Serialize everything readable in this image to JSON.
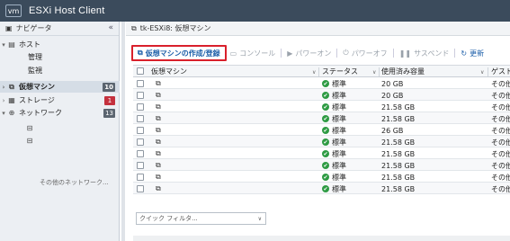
{
  "app": {
    "logo": "vm",
    "title": "ESXi Host Client"
  },
  "sidebar": {
    "header": "ナビゲータ",
    "collapse": "«",
    "host": "ホスト",
    "manage": "管理",
    "monitor": "監視",
    "vms": {
      "label": "仮想マシン",
      "count": "10"
    },
    "storage": {
      "label": "ストレージ",
      "count": "1"
    },
    "network": {
      "label": "ネットワーク",
      "count": "13"
    },
    "more": "その他のネットワーク..."
  },
  "main": {
    "breadcrumb": "tk-ESXi8: 仮想マシン",
    "toolbar": {
      "create": "仮想マシンの作成/登録",
      "console": "コンソール",
      "power_on": "パワーオン",
      "power_off": "パワーオフ",
      "suspend": "サスペンド",
      "refresh": "更新"
    },
    "columns": {
      "name": "仮想マシン",
      "status": "ステータス",
      "used": "使用済み容量",
      "guest": "ゲスト"
    },
    "rows": [
      {
        "status": "標準",
        "used": "20 GB",
        "guest": "その他"
      },
      {
        "status": "標準",
        "used": "20 GB",
        "guest": "その他"
      },
      {
        "status": "標準",
        "used": "21.58 GB",
        "guest": "その他"
      },
      {
        "status": "標準",
        "used": "21.58 GB",
        "guest": "その他"
      },
      {
        "status": "標準",
        "used": "26 GB",
        "guest": "その他"
      },
      {
        "status": "標準",
        "used": "21.58 GB",
        "guest": "その他"
      },
      {
        "status": "標準",
        "used": "21.58 GB",
        "guest": "その他"
      },
      {
        "status": "標準",
        "used": "21.58 GB",
        "guest": "その他"
      },
      {
        "status": "標準",
        "used": "21.58 GB",
        "guest": "その他"
      },
      {
        "status": "標準",
        "used": "21.58 GB",
        "guest": "その他"
      }
    ],
    "filter_placeholder": "クイック フィルタ..."
  }
}
